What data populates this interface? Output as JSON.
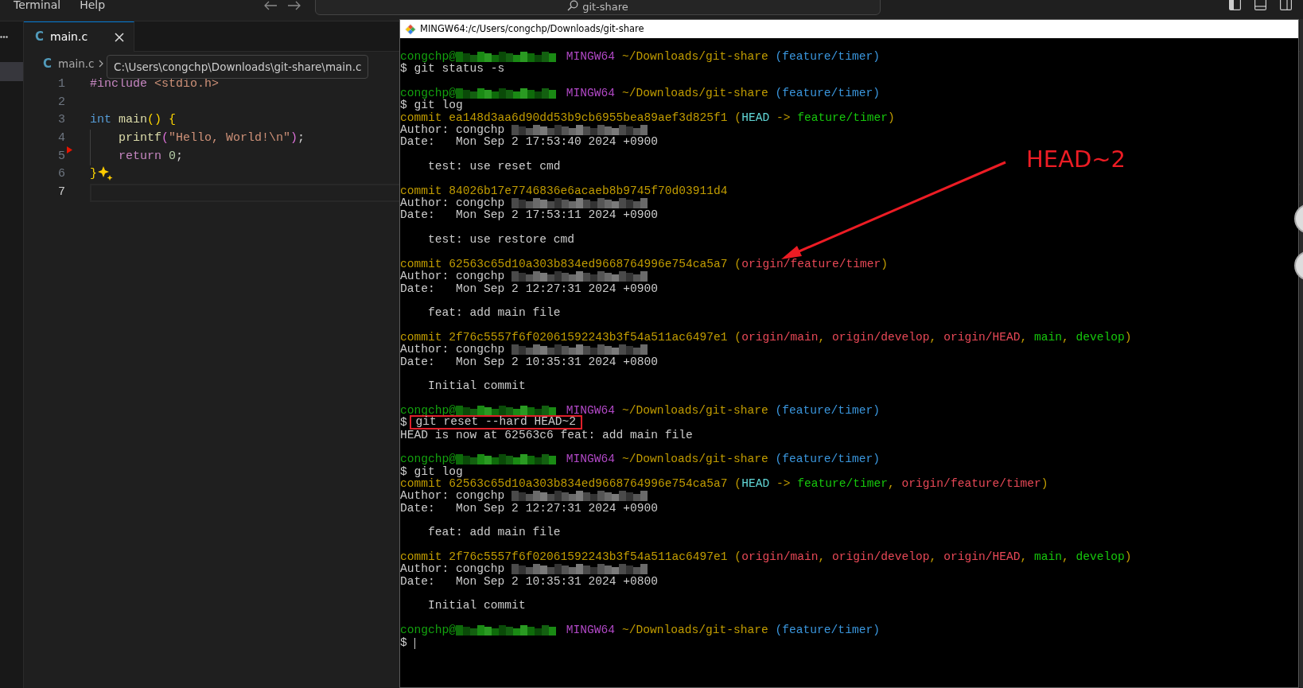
{
  "menu": {
    "items": [
      "Terminal",
      "Help"
    ]
  },
  "search": {
    "text": "git-share"
  },
  "editor": {
    "tab": {
      "icon": "C",
      "label": "main.c",
      "selected": true
    },
    "breadcrumb": {
      "icon": "C",
      "label": "main.c"
    },
    "tooltip": "C:\\Users\\congchp\\Downloads\\git-share\\main.c",
    "lines": [
      {
        "number": "1",
        "kind": "plain",
        "selected": false,
        "marker": false,
        "sparkle": false,
        "tokens": [
          {
            "text": "#include ",
            "color": "#c586c0"
          },
          {
            "text": "<stdio.h>",
            "color": "#ce9178"
          }
        ]
      },
      {
        "number": "2",
        "kind": "plain",
        "selected": false,
        "marker": false,
        "sparkle": false
      },
      {
        "number": "3",
        "kind": "plain",
        "selected": false,
        "marker": false,
        "sparkle": false,
        "tokens": [
          {
            "text": "int ",
            "color": "#569cd6"
          },
          {
            "text": "main",
            "color": "#dcdcaa"
          },
          {
            "text": "() {",
            "color": "#ffd700"
          }
        ]
      },
      {
        "number": "4",
        "kind": "indented",
        "selected": false,
        "marker": false,
        "sparkle": false,
        "tokens": [
          {
            "text": "printf",
            "color": "#dcdcaa"
          },
          {
            "text": "(",
            "color": "#da70d6"
          },
          {
            "text": "\"Hello, World!\\n\"",
            "color": "#ce9178"
          },
          {
            "text": ")",
            "color": "#da70d6"
          },
          {
            "text": ";",
            "color": "#d4d4d4"
          }
        ]
      },
      {
        "number": "5",
        "kind": "indented",
        "selected": false,
        "marker": true,
        "sparkle": false,
        "tokens": [
          {
            "text": "return ",
            "color": "#c586c0"
          },
          {
            "text": "0",
            "color": "#b5cea8"
          },
          {
            "text": ";",
            "color": "#d4d4d4"
          }
        ]
      },
      {
        "number": "6",
        "kind": "plain",
        "selected": false,
        "marker": false,
        "sparkle": true,
        "tokens": [
          {
            "text": "}",
            "color": "#ffd700"
          }
        ]
      },
      {
        "number": "7",
        "kind": "plain",
        "selected": true,
        "marker": false,
        "sparkle": false
      }
    ]
  },
  "terminal": {
    "title": "MINGW64:/c/Users/congchp/Downloads/git-share",
    "lines": [
      {
        "kind": "text",
        "segments": [
          {
            "text": "congchp@",
            "color": "#13a10e"
          },
          {
            "kind": "redacted-host"
          },
          {
            "text": " MINGW64",
            "color": "#b148c6"
          },
          {
            "text": " ~/Downloads/git-share",
            "color": "#c19c00"
          },
          {
            "text": " (feature/timer)",
            "color": "#3a96dd"
          }
        ]
      },
      {
        "kind": "text",
        "segments": [
          {
            "text": "$ git status -s",
            "color": "#cccccc"
          }
        ]
      },
      {
        "kind": "blank"
      },
      {
        "kind": "text",
        "segments": [
          {
            "text": "congchp@",
            "color": "#13a10e"
          },
          {
            "kind": "redacted-host"
          },
          {
            "text": " MINGW64",
            "color": "#b148c6"
          },
          {
            "text": " ~/Downloads/git-share",
            "color": "#c19c00"
          },
          {
            "text": " (feature/timer)",
            "color": "#3a96dd"
          }
        ]
      },
      {
        "kind": "text",
        "segments": [
          {
            "text": "$ git log",
            "color": "#cccccc"
          }
        ]
      },
      {
        "kind": "text",
        "segments": [
          {
            "text": "commit ea148d3aa6d90dd53b9cb6955bea89aef3d825f1 (",
            "color": "#c19c00"
          },
          {
            "text": "HEAD",
            "color": "#61d6d6"
          },
          {
            "text": " -> ",
            "color": "#c19c00"
          },
          {
            "text": "feature/timer",
            "color": "#16c60c"
          },
          {
            "text": ")",
            "color": "#c19c00"
          }
        ]
      },
      {
        "kind": "text",
        "segments": [
          {
            "text": "Author: congchp ",
            "color": "#cccccc"
          },
          {
            "kind": "redacted-email"
          }
        ]
      },
      {
        "kind": "text",
        "segments": [
          {
            "text": "Date:   Mon Sep 2 17:53:40 2024 +0900",
            "color": "#cccccc"
          }
        ]
      },
      {
        "kind": "blank"
      },
      {
        "kind": "text",
        "segments": [
          {
            "text": "    test: use reset cmd",
            "color": "#cccccc"
          }
        ]
      },
      {
        "kind": "blank"
      },
      {
        "kind": "text",
        "segments": [
          {
            "text": "commit 84026b17e7746836e6acaeb8b9745f70d03911d4",
            "color": "#c19c00"
          }
        ]
      },
      {
        "kind": "text",
        "segments": [
          {
            "text": "Author: congchp ",
            "color": "#cccccc"
          },
          {
            "kind": "redacted-email"
          }
        ]
      },
      {
        "kind": "text",
        "segments": [
          {
            "text": "Date:   Mon Sep 2 17:53:11 2024 +0900",
            "color": "#cccccc"
          }
        ]
      },
      {
        "kind": "blank"
      },
      {
        "kind": "text",
        "segments": [
          {
            "text": "    test: use restore cmd",
            "color": "#cccccc"
          }
        ]
      },
      {
        "kind": "blank"
      },
      {
        "kind": "text",
        "segments": [
          {
            "text": "commit 62563c65d10a303b834ed9668764996e754ca5a7 (",
            "color": "#c19c00"
          },
          {
            "text": "origin/feature/timer",
            "color": "#e74856"
          },
          {
            "text": ")",
            "color": "#c19c00"
          }
        ]
      },
      {
        "kind": "text",
        "segments": [
          {
            "text": "Author: congchp ",
            "color": "#cccccc"
          },
          {
            "kind": "redacted-email"
          }
        ]
      },
      {
        "kind": "text",
        "segments": [
          {
            "text": "Date:   Mon Sep 2 12:27:31 2024 +0900",
            "color": "#cccccc"
          }
        ]
      },
      {
        "kind": "blank"
      },
      {
        "kind": "text",
        "segments": [
          {
            "text": "    feat: add main file",
            "color": "#cccccc"
          }
        ]
      },
      {
        "kind": "blank"
      },
      {
        "kind": "text",
        "segments": [
          {
            "text": "commit 2f76c5557f6f02061592243b3f54a511ac6497e1 (",
            "color": "#c19c00"
          },
          {
            "text": "origin/main",
            "color": "#e74856"
          },
          {
            "kind": "separator",
            "text": ", "
          },
          {
            "text": "origin/develop",
            "color": "#e74856"
          },
          {
            "kind": "separator",
            "text": ", "
          },
          {
            "text": "origin/HEAD",
            "color": "#e74856"
          },
          {
            "kind": "separator",
            "text": ", "
          },
          {
            "text": "main",
            "color": "#16c60c"
          },
          {
            "kind": "separator",
            "text": ", "
          },
          {
            "text": "develop",
            "color": "#16c60c"
          },
          {
            "text": ")",
            "color": "#c19c00"
          }
        ]
      },
      {
        "kind": "text",
        "segments": [
          {
            "text": "Author: congchp ",
            "color": "#cccccc"
          },
          {
            "kind": "redacted-email"
          }
        ]
      },
      {
        "kind": "text",
        "segments": [
          {
            "text": "Date:   Mon Sep 2 10:35:31 2024 +0800",
            "color": "#cccccc"
          }
        ]
      },
      {
        "kind": "blank"
      },
      {
        "kind": "text",
        "segments": [
          {
            "text": "    Initial commit",
            "color": "#cccccc"
          }
        ]
      },
      {
        "kind": "blank"
      },
      {
        "kind": "text",
        "segments": [
          {
            "text": "congchp@",
            "color": "#13a10e"
          },
          {
            "kind": "redacted-host"
          },
          {
            "text": " MINGW64",
            "color": "#b148c6"
          },
          {
            "text": " ~/Downloads/git-share",
            "color": "#c19c00"
          },
          {
            "text": " (feature/timer)",
            "color": "#3a96dd"
          }
        ]
      },
      {
        "kind": "text",
        "segments": [
          {
            "text": "$ ",
            "color": "#cccccc"
          },
          {
            "text": "git reset --hard HEAD~2",
            "color": "#cccccc",
            "highlighted": true
          }
        ]
      },
      {
        "kind": "text",
        "segments": [
          {
            "text": "HEAD is now at 62563c6 feat: add main file",
            "color": "#cccccc"
          }
        ]
      },
      {
        "kind": "blank"
      },
      {
        "kind": "text",
        "segments": [
          {
            "text": "congchp@",
            "color": "#13a10e"
          },
          {
            "kind": "redacted-host"
          },
          {
            "text": " MINGW64",
            "color": "#b148c6"
          },
          {
            "text": " ~/Downloads/git-share",
            "color": "#c19c00"
          },
          {
            "text": " (feature/timer)",
            "color": "#3a96dd"
          }
        ]
      },
      {
        "kind": "text",
        "segments": [
          {
            "text": "$ git log",
            "color": "#cccccc"
          }
        ]
      },
      {
        "kind": "text",
        "segments": [
          {
            "text": "commit 62563c65d10a303b834ed9668764996e754ca5a7 (",
            "color": "#c19c00"
          },
          {
            "text": "HEAD",
            "color": "#61d6d6"
          },
          {
            "text": " -> ",
            "color": "#c19c00"
          },
          {
            "text": "feature/timer",
            "color": "#16c60c"
          },
          {
            "kind": "separator",
            "text": ", "
          },
          {
            "text": "origin/feature/timer",
            "color": "#e74856"
          },
          {
            "text": ")",
            "color": "#c19c00"
          }
        ]
      },
      {
        "kind": "text",
        "segments": [
          {
            "text": "Author: congchp ",
            "color": "#cccccc"
          },
          {
            "kind": "redacted-email"
          }
        ]
      },
      {
        "kind": "text",
        "segments": [
          {
            "text": "Date:   Mon Sep 2 12:27:31 2024 +0900",
            "color": "#cccccc"
          }
        ]
      },
      {
        "kind": "blank"
      },
      {
        "kind": "text",
        "segments": [
          {
            "text": "    feat: add main file",
            "color": "#cccccc"
          }
        ]
      },
      {
        "kind": "blank"
      },
      {
        "kind": "text",
        "segments": [
          {
            "text": "commit 2f76c5557f6f02061592243b3f54a511ac6497e1 (",
            "color": "#c19c00"
          },
          {
            "text": "origin/main",
            "color": "#e74856"
          },
          {
            "kind": "separator",
            "text": ", "
          },
          {
            "text": "origin/develop",
            "color": "#e74856"
          },
          {
            "kind": "separator",
            "text": ", "
          },
          {
            "text": "origin/HEAD",
            "color": "#e74856"
          },
          {
            "kind": "separator",
            "text": ", "
          },
          {
            "text": "main",
            "color": "#16c60c"
          },
          {
            "kind": "separator",
            "text": ", "
          },
          {
            "text": "develop",
            "color": "#16c60c"
          },
          {
            "text": ")",
            "color": "#c19c00"
          }
        ]
      },
      {
        "kind": "text",
        "segments": [
          {
            "text": "Author: congchp ",
            "color": "#cccccc"
          },
          {
            "kind": "redacted-email"
          }
        ]
      },
      {
        "kind": "text",
        "segments": [
          {
            "text": "Date:   Mon Sep 2 10:35:31 2024 +0800",
            "color": "#cccccc"
          }
        ]
      },
      {
        "kind": "blank"
      },
      {
        "kind": "text",
        "segments": [
          {
            "text": "    Initial commit",
            "color": "#cccccc"
          }
        ]
      },
      {
        "kind": "blank"
      },
      {
        "kind": "text",
        "segments": [
          {
            "text": "congchp@",
            "color": "#13a10e"
          },
          {
            "kind": "redacted-host"
          },
          {
            "text": " MINGW64",
            "color": "#b148c6"
          },
          {
            "text": " ~/Downloads/git-share",
            "color": "#c19c00"
          },
          {
            "text": " (feature/timer)",
            "color": "#3a96dd"
          }
        ]
      },
      {
        "kind": "text",
        "segments": [
          {
            "text": "$ ",
            "color": "#cccccc"
          },
          {
            "kind": "cursor"
          }
        ]
      }
    ]
  },
  "annotations": [
    {
      "kind": "arrow"
    },
    {
      "kind": "label",
      "text": "HEAD~2"
    }
  ]
}
